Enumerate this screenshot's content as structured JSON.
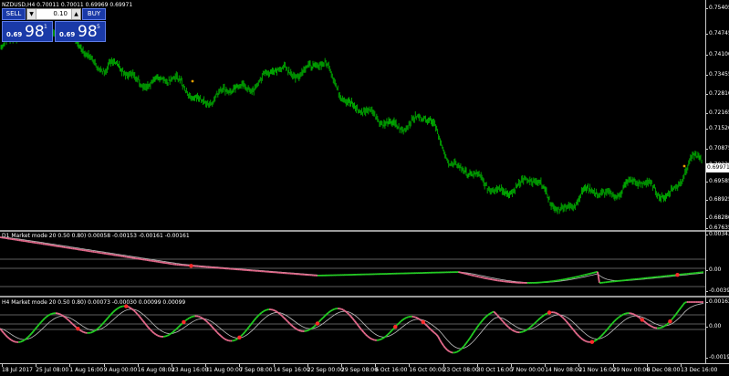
{
  "symbol_info": "NZDUSD,H4  0.70011 0.70011 0.69969 0.69971",
  "trade_panel": {
    "sell_label": "SELL",
    "buy_label": "BUY",
    "lot_value": "0.10",
    "spin_down": "▼",
    "spin_up": "▲",
    "sell_price": {
      "small": "0.69",
      "big": "98",
      "sup": "1"
    },
    "buy_price": {
      "small": "0.69",
      "big": "98",
      "sup": "5"
    }
  },
  "current_price_label": "0.69971",
  "colors": {
    "background": "#000000",
    "candles": "#00a000",
    "trend_up": "#22cc22",
    "trend_down": "#e46a8c",
    "signal_line": "#c0c0c0",
    "signal_dot": "#ff2a2a",
    "marker_dot": "#e8a000",
    "panel_blue": "#1a3aa8"
  },
  "price_axis": [
    "0.75405",
    "0.74745",
    "0.74100",
    "0.73455",
    "0.72810",
    "0.72165",
    "0.71520",
    "0.70875",
    "0.70230",
    "0.69585",
    "0.68925",
    "0.68280",
    "0.67635"
  ],
  "indicator1": {
    "title": "D1 Market mode 20 0.50 0.80) 0.00058 -0.00153 -0.00161 -0.00161",
    "axis": [
      "0.00343",
      "0.00",
      "-0.00391"
    ]
  },
  "indicator2": {
    "title": "H4 Market mode 20 0.50 0.80) 0.00073 -0.00030 0.00099 0.00099",
    "axis": [
      "0.00162",
      "0.00",
      "-0.00193"
    ]
  },
  "time_axis": [
    "18 Jul 2017",
    "25 Jul 08:00",
    "1 Aug 16:00",
    "9 Aug 00:00",
    "16 Aug 08:00",
    "23 Aug 16:00",
    "31 Aug 00:00",
    "7 Sep 08:00",
    "14 Sep 16:00",
    "22 Sep 00:00",
    "29 Sep 08:00",
    "6 Oct 16:00",
    "16 Oct 00:00",
    "23 Oct 08:00",
    "30 Oct 16:00",
    "7 Nov 00:00",
    "14 Nov 08:00",
    "21 Nov 16:00",
    "29 Nov 00:00",
    "6 Dec 08:00",
    "13 Dec 16:00"
  ],
  "chart_data": {
    "type": "line",
    "title": "NZDUSD,H4",
    "ylim": [
      0.674,
      0.756
    ],
    "x": [
      "18 Jul 2017",
      "25 Jul 08:00",
      "1 Aug 16:00",
      "9 Aug 00:00",
      "16 Aug 08:00",
      "23 Aug 16:00",
      "31 Aug 00:00",
      "7 Sep 08:00",
      "14 Sep 16:00",
      "22 Sep 00:00",
      "29 Sep 08:00",
      "6 Oct 16:00",
      "16 Oct 00:00",
      "23 Oct 08:00",
      "30 Oct 16:00",
      "7 Nov 00:00",
      "14 Nov 08:00",
      "21 Nov 16:00",
      "29 Nov 00:00",
      "6 Dec 08:00",
      "13 Dec 16:00"
    ],
    "series": [
      {
        "values": [
          0.739,
          0.746,
          0.742,
          0.732,
          0.728,
          0.726,
          0.72,
          0.726,
          0.73,
          0.733,
          0.72,
          0.711,
          0.714,
          0.698,
          0.688,
          0.691,
          0.683,
          0.687,
          0.69,
          0.688,
          0.699
        ]
      }
    ]
  }
}
